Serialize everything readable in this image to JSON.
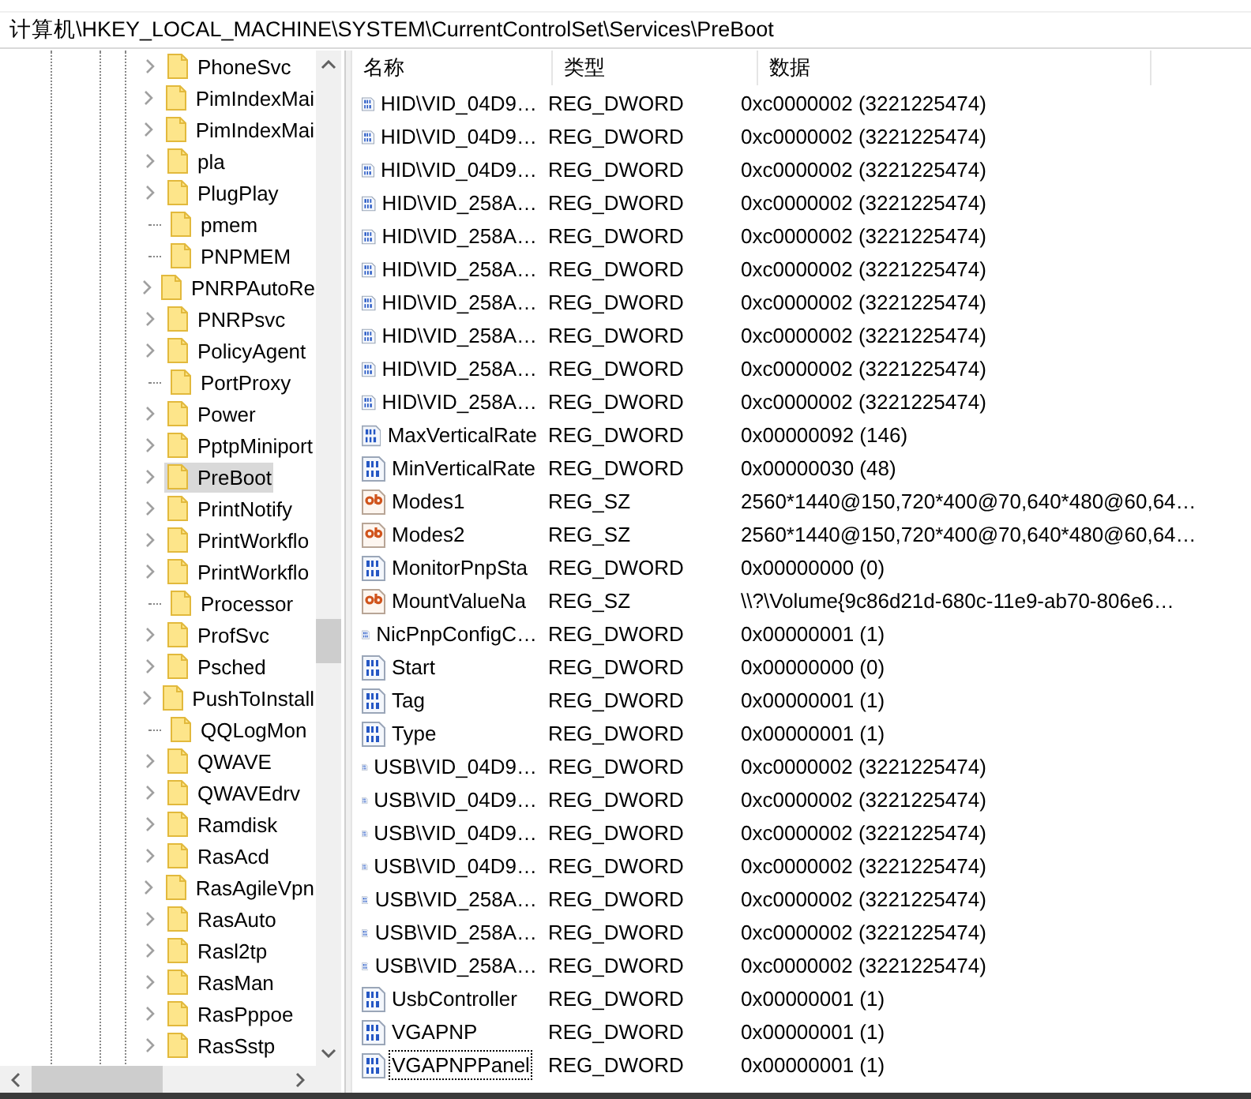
{
  "address_bar": {
    "value": "计算机\\HKEY_LOCAL_MACHINE\\SYSTEM\\CurrentControlSet\\Services\\PreBoot"
  },
  "tree": {
    "items": [
      {
        "label": "PhoneSvc",
        "has_children": true,
        "selected": false
      },
      {
        "label": "PimIndexMai",
        "has_children": true,
        "selected": false
      },
      {
        "label": "PimIndexMai",
        "has_children": true,
        "selected": false
      },
      {
        "label": "pla",
        "has_children": true,
        "selected": false
      },
      {
        "label": "PlugPlay",
        "has_children": true,
        "selected": false
      },
      {
        "label": "pmem",
        "has_children": false,
        "selected": false
      },
      {
        "label": "PNPMEM",
        "has_children": false,
        "selected": false
      },
      {
        "label": "PNRPAutoRe",
        "has_children": true,
        "selected": false
      },
      {
        "label": "PNRPsvc",
        "has_children": true,
        "selected": false
      },
      {
        "label": "PolicyAgent",
        "has_children": true,
        "selected": false
      },
      {
        "label": "PortProxy",
        "has_children": false,
        "selected": false
      },
      {
        "label": "Power",
        "has_children": true,
        "selected": false
      },
      {
        "label": "PptpMiniport",
        "has_children": true,
        "selected": false
      },
      {
        "label": "PreBoot",
        "has_children": true,
        "selected": true
      },
      {
        "label": "PrintNotify",
        "has_children": true,
        "selected": false
      },
      {
        "label": "PrintWorkflo",
        "has_children": true,
        "selected": false
      },
      {
        "label": "PrintWorkflo",
        "has_children": true,
        "selected": false
      },
      {
        "label": "Processor",
        "has_children": false,
        "selected": false
      },
      {
        "label": "ProfSvc",
        "has_children": true,
        "selected": false
      },
      {
        "label": "Psched",
        "has_children": true,
        "selected": false
      },
      {
        "label": "PushToInstall",
        "has_children": true,
        "selected": false
      },
      {
        "label": "QQLogMon",
        "has_children": false,
        "selected": false
      },
      {
        "label": "QWAVE",
        "has_children": true,
        "selected": false
      },
      {
        "label": "QWAVEdrv",
        "has_children": true,
        "selected": false
      },
      {
        "label": "Ramdisk",
        "has_children": true,
        "selected": false
      },
      {
        "label": "RasAcd",
        "has_children": true,
        "selected": false
      },
      {
        "label": "RasAgileVpn",
        "has_children": true,
        "selected": false
      },
      {
        "label": "RasAuto",
        "has_children": true,
        "selected": false
      },
      {
        "label": "Rasl2tp",
        "has_children": true,
        "selected": false
      },
      {
        "label": "RasMan",
        "has_children": true,
        "selected": false
      },
      {
        "label": "RasPppoe",
        "has_children": true,
        "selected": false
      },
      {
        "label": "RasSstp",
        "has_children": true,
        "selected": false
      }
    ]
  },
  "values_table": {
    "columns": [
      "名称",
      "类型",
      "数据"
    ],
    "rows": [
      {
        "kind": "dword",
        "name": "HID\\VID_04D9…",
        "type": "REG_DWORD",
        "data": "0xc0000002 (3221225474)",
        "focused": false
      },
      {
        "kind": "dword",
        "name": "HID\\VID_04D9…",
        "type": "REG_DWORD",
        "data": "0xc0000002 (3221225474)",
        "focused": false
      },
      {
        "kind": "dword",
        "name": "HID\\VID_04D9…",
        "type": "REG_DWORD",
        "data": "0xc0000002 (3221225474)",
        "focused": false
      },
      {
        "kind": "dword",
        "name": "HID\\VID_258A…",
        "type": "REG_DWORD",
        "data": "0xc0000002 (3221225474)",
        "focused": false
      },
      {
        "kind": "dword",
        "name": "HID\\VID_258A…",
        "type": "REG_DWORD",
        "data": "0xc0000002 (3221225474)",
        "focused": false
      },
      {
        "kind": "dword",
        "name": "HID\\VID_258A…",
        "type": "REG_DWORD",
        "data": "0xc0000002 (3221225474)",
        "focused": false
      },
      {
        "kind": "dword",
        "name": "HID\\VID_258A…",
        "type": "REG_DWORD",
        "data": "0xc0000002 (3221225474)",
        "focused": false
      },
      {
        "kind": "dword",
        "name": "HID\\VID_258A…",
        "type": "REG_DWORD",
        "data": "0xc0000002 (3221225474)",
        "focused": false
      },
      {
        "kind": "dword",
        "name": "HID\\VID_258A…",
        "type": "REG_DWORD",
        "data": "0xc0000002 (3221225474)",
        "focused": false
      },
      {
        "kind": "dword",
        "name": "HID\\VID_258A…",
        "type": "REG_DWORD",
        "data": "0xc0000002 (3221225474)",
        "focused": false
      },
      {
        "kind": "dword",
        "name": "MaxVerticalRate",
        "type": "REG_DWORD",
        "data": "0x00000092 (146)",
        "focused": false
      },
      {
        "kind": "dword",
        "name": "MinVerticalRate",
        "type": "REG_DWORD",
        "data": "0x00000030 (48)",
        "focused": false
      },
      {
        "kind": "sz",
        "name": "Modes1",
        "type": "REG_SZ",
        "data": "2560*1440@150,720*400@70,640*480@60,64…",
        "focused": false
      },
      {
        "kind": "sz",
        "name": "Modes2",
        "type": "REG_SZ",
        "data": "2560*1440@150,720*400@70,640*480@60,64…",
        "focused": false
      },
      {
        "kind": "dword",
        "name": "MonitorPnpSta",
        "type": "REG_DWORD",
        "data": "0x00000000 (0)",
        "focused": false
      },
      {
        "kind": "sz",
        "name": "MountValueNa",
        "type": "REG_SZ",
        "data": "\\\\?\\Volume{9c86d21d-680c-11e9-ab70-806e6…",
        "focused": false
      },
      {
        "kind": "dword",
        "name": "NicPnpConfigC…",
        "type": "REG_DWORD",
        "data": "0x00000001 (1)",
        "focused": false
      },
      {
        "kind": "dword",
        "name": "Start",
        "type": "REG_DWORD",
        "data": "0x00000000 (0)",
        "focused": false
      },
      {
        "kind": "dword",
        "name": "Tag",
        "type": "REG_DWORD",
        "data": "0x00000001 (1)",
        "focused": false
      },
      {
        "kind": "dword",
        "name": "Type",
        "type": "REG_DWORD",
        "data": "0x00000001 (1)",
        "focused": false
      },
      {
        "kind": "dword",
        "name": "USB\\VID_04D9…",
        "type": "REG_DWORD",
        "data": "0xc0000002 (3221225474)",
        "focused": false
      },
      {
        "kind": "dword",
        "name": "USB\\VID_04D9…",
        "type": "REG_DWORD",
        "data": "0xc0000002 (3221225474)",
        "focused": false
      },
      {
        "kind": "dword",
        "name": "USB\\VID_04D9…",
        "type": "REG_DWORD",
        "data": "0xc0000002 (3221225474)",
        "focused": false
      },
      {
        "kind": "dword",
        "name": "USB\\VID_04D9…",
        "type": "REG_DWORD",
        "data": "0xc0000002 (3221225474)",
        "focused": false
      },
      {
        "kind": "dword",
        "name": "USB\\VID_258A…",
        "type": "REG_DWORD",
        "data": "0xc0000002 (3221225474)",
        "focused": false
      },
      {
        "kind": "dword",
        "name": "USB\\VID_258A…",
        "type": "REG_DWORD",
        "data": "0xc0000002 (3221225474)",
        "focused": false
      },
      {
        "kind": "dword",
        "name": "USB\\VID_258A…",
        "type": "REG_DWORD",
        "data": "0xc0000002 (3221225474)",
        "focused": false
      },
      {
        "kind": "dword",
        "name": "UsbController",
        "type": "REG_DWORD",
        "data": "0x00000001 (1)",
        "focused": false
      },
      {
        "kind": "dword",
        "name": "VGAPNP",
        "type": "REG_DWORD",
        "data": "0x00000001 (1)",
        "focused": false
      },
      {
        "kind": "dword",
        "name": "VGAPNPPanel",
        "type": "REG_DWORD",
        "data": "0x00000001 (1)",
        "focused": true
      }
    ]
  }
}
